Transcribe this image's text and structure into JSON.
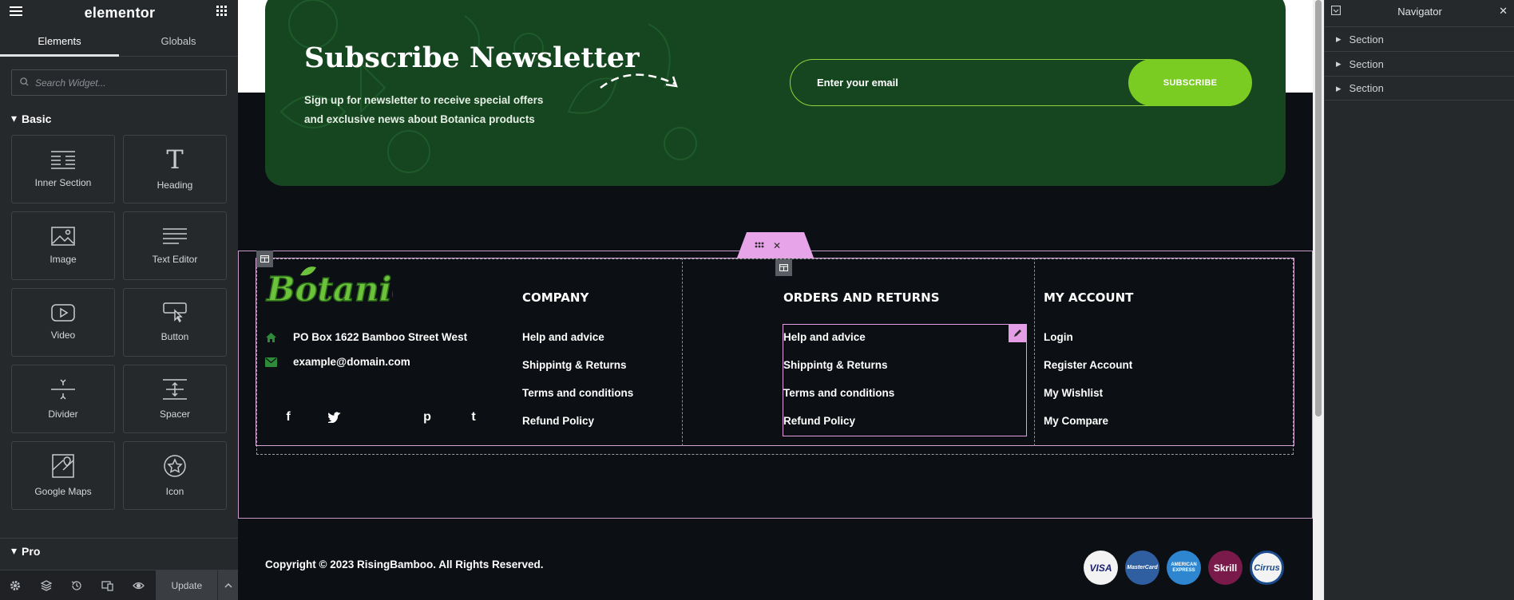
{
  "editor": {
    "logo": "elementor",
    "tabs": [
      "Elements",
      "Globals"
    ],
    "search_placeholder": "Search Widget...",
    "category_basic": "Basic",
    "category_pro": "Pro",
    "widgets": [
      {
        "label": "Inner Section",
        "icon": "inner-section-icon"
      },
      {
        "label": "Heading",
        "icon": "heading-icon"
      },
      {
        "label": "Image",
        "icon": "image-icon"
      },
      {
        "label": "Text Editor",
        "icon": "text-editor-icon"
      },
      {
        "label": "Video",
        "icon": "video-icon"
      },
      {
        "label": "Button",
        "icon": "button-icon"
      },
      {
        "label": "Divider",
        "icon": "divider-icon"
      },
      {
        "label": "Spacer",
        "icon": "spacer-icon"
      },
      {
        "label": "Google Maps",
        "icon": "google-maps-icon"
      },
      {
        "label": "Icon",
        "icon": "star-icon"
      }
    ],
    "update_label": "Update"
  },
  "newsletter": {
    "title": "Subscribe Newsletter",
    "subtitle": "Sign up for newsletter to receive special offers and exclusive news about Botanica products",
    "email_placeholder": "Enter your email",
    "button": "SUBSCRIBE"
  },
  "footer": {
    "brand": "Botanica",
    "address": "PO Box 1622 Bamboo Street West",
    "email": "example@domain.com",
    "social": [
      "f",
      "t",
      "p",
      "t"
    ],
    "columns": [
      {
        "title": "COMPANY",
        "links": [
          "Help and advice",
          "Shippintg & Returns",
          "Terms and conditions",
          "Refund Policy"
        ]
      },
      {
        "title": "ORDERS AND RETURNS",
        "links": [
          "Help and advice",
          "Shippintg & Returns",
          "Terms and conditions",
          "Refund Policy"
        ]
      },
      {
        "title": "MY ACCOUNT",
        "links": [
          "Login",
          "Register Account",
          "My Wishlist",
          "My Compare"
        ]
      }
    ],
    "copyright": "Copyright © 2023 RisingBamboo. All Rights Reserved.",
    "payments": [
      "VISA",
      "MasterCard",
      "AMERICAN EXPRESS",
      "Skrill",
      "Cirrus"
    ]
  },
  "navigator": {
    "title": "Navigator",
    "items": [
      "Section",
      "Section",
      "Section"
    ]
  },
  "colors": {
    "newsletter_bg": "#15461f",
    "accent_green": "#7acc22",
    "canvas_bg": "#0c0f14",
    "editor_panel": "#26292c",
    "selection_pink": "#e59ee5"
  }
}
